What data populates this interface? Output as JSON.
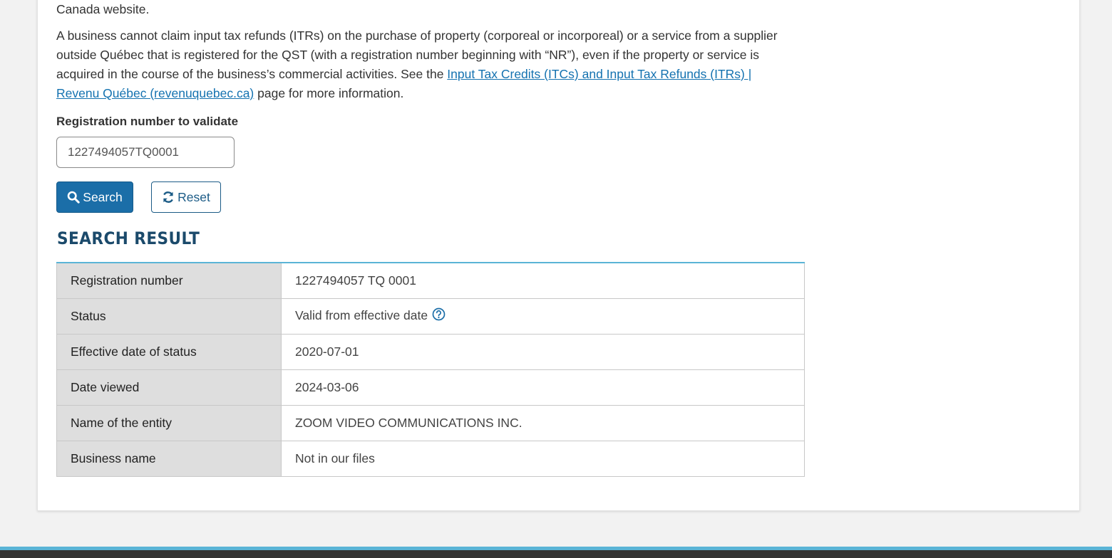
{
  "intro": {
    "tail_text": "Canada website.",
    "para_before_link": "A business cannot claim input tax refunds (ITRs) on the purchase of property (corporeal or incorporeal) or a service from a supplier outside Québec that is registered for the QST (with a registration number beginning with “NR”), even if the property or service is acquired in the course of the business’s commercial activities. See the ",
    "link_text": "Input Tax Credits (ITCs) and Input Tax Refunds (ITRs) | Revenu Québec (revenuquebec.ca)",
    "para_after_link": " page for more information."
  },
  "form": {
    "label": "Registration number to validate",
    "input_value": "1227494057TQ0001",
    "search_label": "Search",
    "reset_label": "Reset"
  },
  "result": {
    "title": "SEARCH RESULT",
    "rows": [
      {
        "key": "Registration number",
        "value": "1227494057 TQ 0001"
      },
      {
        "key": "Status",
        "value": "Valid from effective date"
      },
      {
        "key": "Effective date of status",
        "value": "2020-07-01"
      },
      {
        "key": "Date viewed",
        "value": "2024-03-06"
      },
      {
        "key": "Name of the entity",
        "value": "ZOOM VIDEO COMMUNICATIONS INC."
      },
      {
        "key": "Business name",
        "value": "Not in our files"
      }
    ]
  },
  "icons": {
    "search": "search-icon",
    "reset": "refresh-icon",
    "help": "question-circle-icon"
  },
  "colors": {
    "primary": "#1b6ea8",
    "heading": "#1b4a6b",
    "accent": "#5ab4d6",
    "link": "#1472b0"
  }
}
